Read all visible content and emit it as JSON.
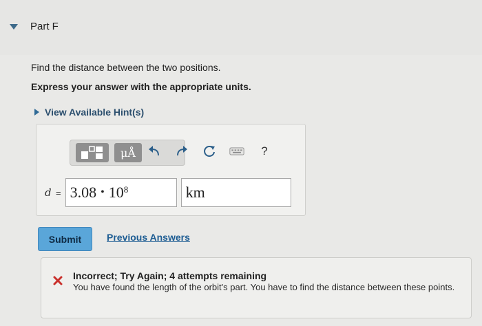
{
  "part": {
    "title": "Part F"
  },
  "question": {
    "text": "Find the distance between the two positions.",
    "instruction": "Express your answer with the appropriate units."
  },
  "hint": {
    "label": "View Available Hint(s)"
  },
  "toolbar": {
    "templates_icon": "templates-icon",
    "units_label": "μÅ",
    "undo_icon": "undo-icon",
    "redo_icon": "redo-icon",
    "reset_icon": "reset-icon",
    "keyboard_icon": "keyboard-icon",
    "help_label": "?"
  },
  "answer": {
    "variable": "d",
    "equals": "=",
    "mantissa": "3.08",
    "dot": "•",
    "base": "10",
    "exponent": "8",
    "unit": "km"
  },
  "actions": {
    "submit_label": "Submit",
    "previous_answers_label": "Previous Answers"
  },
  "feedback": {
    "title": "Incorrect; Try Again; 4 attempts remaining",
    "body": "You have found the length of the orbit's part. You have to find the distance between these points.",
    "status_color": "#c9302c"
  }
}
